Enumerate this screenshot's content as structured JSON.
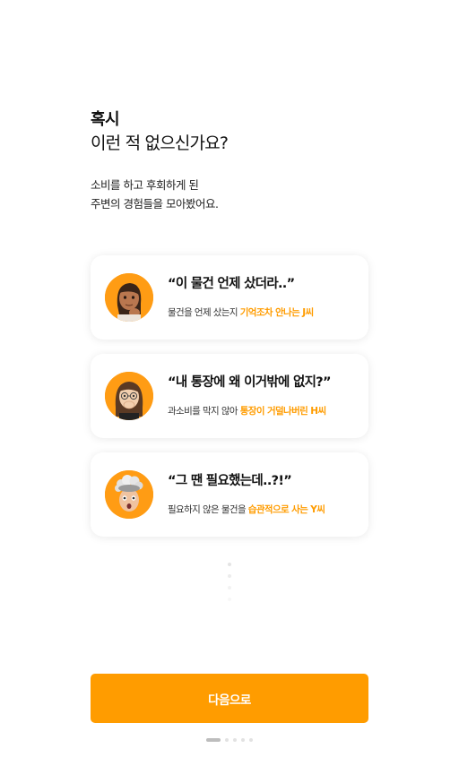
{
  "header": {
    "highlight": "혹시",
    "title": "이런 적 없으신가요?"
  },
  "subtitle": {
    "line1": "소비를 하고 후회하게 된",
    "line2": "주변의 경험들을 모아봤어요."
  },
  "cards": [
    {
      "quote": "“이 물건 언제 샀더라..”",
      "desc_prefix": "물건을 언제 샀는지 ",
      "desc_accent": "기억조차 안나는 J씨",
      "avatar": "thinking-woman-avatar-icon"
    },
    {
      "quote": "“내 통장에 왜 이거밖에 없지?”",
      "desc_prefix": "과소비를 막지 않아 ",
      "desc_accent": "통장이 거덜나버린 H씨",
      "avatar": "shocked-woman-avatar-icon"
    },
    {
      "quote": "“그 땐 필요했는데..?!”",
      "desc_prefix": "필요하지 않은 물건을 ",
      "desc_accent": "습관적으로 사는 Y씨",
      "avatar": "mind-blown-avatar-icon"
    }
  ],
  "button": {
    "label": "다음으로"
  },
  "pager": {
    "total": 5,
    "active": 1
  },
  "colors": {
    "accent": "#ff9c00",
    "highlight": "#ffdc8a",
    "avatar_bg": "#ff9c14"
  }
}
